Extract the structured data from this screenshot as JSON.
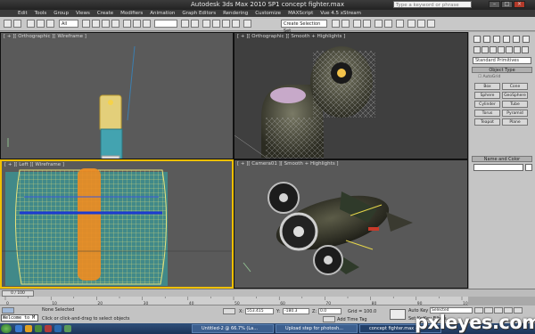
{
  "window": {
    "title": "Autodesk 3ds Max 2010 SP1  concept fighter.max",
    "search_placeholder": "Type a keyword or phrase"
  },
  "menu": [
    "Edit",
    "Tools",
    "Group",
    "Views",
    "Create",
    "Modifiers",
    "Animation",
    "Graph Editors",
    "Rendering",
    "Customize",
    "MAXScript",
    "Vue 4.5 xStream"
  ],
  "toolbar": {
    "selection_filter": "All",
    "selection_set": "Create Selection Set"
  },
  "viewports": {
    "top_left": "[ + ][ Orthographic ][ Wireframe ]",
    "top_right": "[ + ][ Orthographic ][ Smooth + Highlights ]",
    "bottom_left": "[ + ][ Left ][ Wireframe ]",
    "bottom_right": "[ + ][ Camera01 ][ Smooth + Highlights ]"
  },
  "command_panel": {
    "category_dropdown": "Standard Primitives",
    "object_type_header": "Object Type",
    "autogrid_label": "AutoGrid",
    "buttons": [
      "Box",
      "Cone",
      "Sphere",
      "GeoSphere",
      "Cylinder",
      "Tube",
      "Torus",
      "Pyramid",
      "Teapot",
      "Plane"
    ],
    "name_color_header": "Name and Color"
  },
  "timeline": {
    "frame_display": "0 / 100",
    "ticks": [
      "0",
      "10",
      "20",
      "30",
      "40",
      "50",
      "60",
      "70",
      "80",
      "90",
      "100"
    ]
  },
  "status": {
    "maxscript_text": "Welcome to M",
    "selection_text": "None Selected",
    "prompt_text": "Click or click-and-drag to select objects",
    "x_label": "X:",
    "y_label": "Y:",
    "z_label": "Z:",
    "x_value": "553.415",
    "y_value": "-180.3",
    "z_value": "0.0",
    "grid_text": "Grid = 100.0",
    "add_time_tag": "Add Time Tag",
    "auto_key": "Auto Key",
    "set_key": "Set Key",
    "selected_dropdown": "Selected",
    "key_filters": "Key Filters..."
  },
  "taskbar": {
    "items": [
      "Untitled-2 @ 66.7% (La...",
      "Upload step for photosh...",
      "concept fighter.max - ..."
    ],
    "watermark": "pxleyes.com"
  },
  "colors": {
    "viewport_bg": "#5a5a5a",
    "active_viewport_border": "#f0c000",
    "panel_bg": "#c5c5c5",
    "taskbar": "#1d3458"
  }
}
